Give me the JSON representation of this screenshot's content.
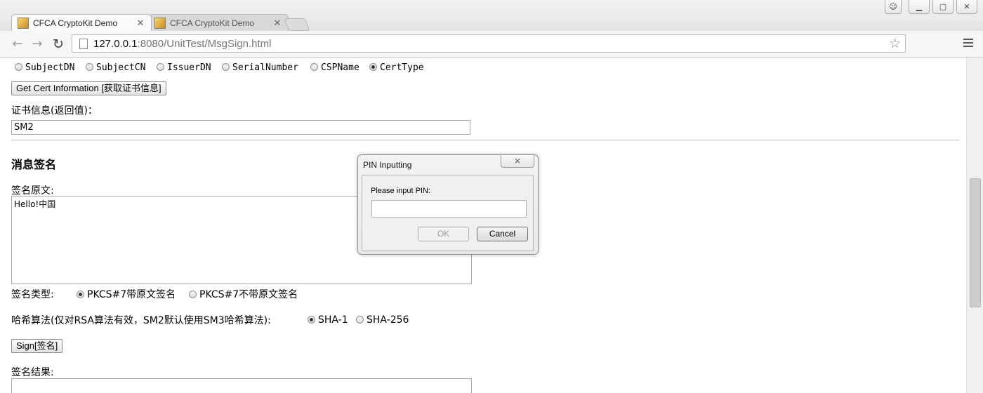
{
  "browser": {
    "tabs": [
      {
        "label": "CFCA CryptoKit Demo",
        "active": true
      },
      {
        "label": "CFCA CryptoKit Demo",
        "active": false
      }
    ],
    "url_host": "127.0.0.1",
    "url_rest": ":8080/UnitTest/MsgSign.html",
    "icons": {
      "back": "back-arrow-icon",
      "forward": "forward-arrow-icon",
      "reload": "reload-icon",
      "star": "star-icon",
      "menu": "hamburger-menu-icon"
    }
  },
  "cert_info": {
    "options": [
      "SubjectDN",
      "SubjectCN",
      "IssuerDN",
      "SerialNumber",
      "CSPName",
      "CertType"
    ],
    "selected": "CertType",
    "get_button": "Get Cert Information [获取证书信息]",
    "result_label": "证书信息(返回值)：",
    "result_value": "SM2"
  },
  "sign": {
    "heading": "消息签名",
    "source_label": "签名原文:",
    "source_value": "Hello!中国",
    "type_label": "签名类型:",
    "type_options": [
      "PKCS#7带原文签名",
      "PKCS#7不带原文签名"
    ],
    "type_selected": "PKCS#7带原文签名",
    "hash_label": "哈希算法(仅对RSA算法有效，SM2默认使用SM3哈希算法):",
    "hash_options": [
      "SHA-1",
      "SHA-256"
    ],
    "hash_selected": "SHA-1",
    "sign_button": "Sign[签名]",
    "result_label": "签名结果:"
  },
  "pin_dialog": {
    "title": "PIN Inputting",
    "prompt": "Please input PIN:",
    "pin_value": "",
    "ok_label": "OK",
    "cancel_label": "Cancel"
  }
}
